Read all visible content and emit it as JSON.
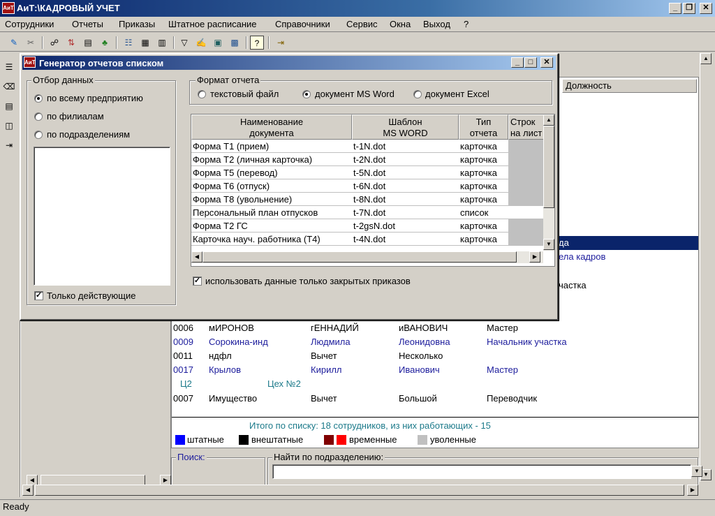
{
  "window": {
    "title": "АиТ:\\КАДРОВЫЙ УЧЕТ",
    "icon": "app-logo-icon"
  },
  "menu": [
    "Сотрудники",
    "Отчеты",
    "Приказы",
    "Штатное расписание",
    "Справочники",
    "Сервис",
    "Окна",
    "Выход",
    "?"
  ],
  "main_list": {
    "column_position": "Должность",
    "partial_rows": [
      {
        "text": "да"
      },
      {
        "text": "ела кадров"
      },
      {
        "text": "частка"
      }
    ],
    "rows": [
      {
        "id": "0006",
        "last": "мИРОНОВ",
        "first": "гЕННАДИЙ",
        "middle": "иВАНОВИЧ",
        "position": "Мастер",
        "style": "black"
      },
      {
        "id": "0009",
        "last": "Сорокина-инд",
        "first": "Людмила",
        "middle": "Леонидовна",
        "position": "Начальник участка",
        "style": "navy"
      },
      {
        "id": "0011",
        "last": "ндфл",
        "first": "Вычет",
        "middle": "Несколько",
        "position": "",
        "style": "black"
      },
      {
        "id": "0017",
        "last": "Крылов",
        "first": "Кирилл",
        "middle": "Иванович",
        "position": "Мастер",
        "style": "navy"
      },
      {
        "id": "",
        "last": "Ц2",
        "first": "Цех №2",
        "middle": "",
        "position": "",
        "style": "teal"
      },
      {
        "id": "0007",
        "last": "Имущество",
        "first": "Вычет",
        "middle": "Большой",
        "position": "Переводчик",
        "style": "black"
      }
    ],
    "total": "Итого по списку: 18 сотрудников, из них работающих - 15",
    "legend": [
      {
        "label": "штатные",
        "colors": [
          "#0000ff"
        ]
      },
      {
        "label": "внештатные",
        "colors": [
          "#000000"
        ]
      },
      {
        "label": "временные",
        "colors": [
          "#800000",
          "#ff0000"
        ]
      },
      {
        "label": "уволенные",
        "colors": [
          "#c0c0c0"
        ]
      }
    ],
    "search_label": "Поиск:",
    "find_by_dept_label": "Найти по подразделению:"
  },
  "dialog": {
    "title": "Генератор отчетов списком",
    "selection_group": "Отбор данных",
    "selection_options": [
      "по всему предприятию",
      "по филиалам",
      "по подразделениям"
    ],
    "selection_checked": 0,
    "only_active_label": "Только действующие",
    "only_active": true,
    "format_group": "Формат отчета",
    "format_options": [
      "текстовый файл",
      "документ MS Word",
      "документ Excel"
    ],
    "format_checked": 1,
    "grid_headers": [
      "Наименование\nдокумента",
      "Шаблон\nMS WORD",
      "Тип\nотчета",
      "Строк\nна лист"
    ],
    "grid_rows": [
      {
        "name": "Форма Т1 (прием)",
        "template": "t-1N.dot",
        "type": "карточка",
        "grey": true
      },
      {
        "name": "Форма Т2 (личная карточка)",
        "template": "t-2N.dot",
        "type": "карточка",
        "grey": true
      },
      {
        "name": "Форма Т5 (перевод)",
        "template": "t-5N.dot",
        "type": "карточка",
        "grey": true
      },
      {
        "name": "Форма Т6 (отпуск)",
        "template": "t-6N.dot",
        "type": "карточка",
        "grey": true
      },
      {
        "name": "Форма Т8 (увольнение)",
        "template": "t-8N.dot",
        "type": "карточка",
        "grey": true
      },
      {
        "name": "Персональный план отпусков",
        "template": "t-7N.dot",
        "type": "список",
        "grey": false
      },
      {
        "name": "Форма Т2 ГС",
        "template": "t-2gsN.dot",
        "type": "карточка",
        "grey": true
      },
      {
        "name": "Карточка науч. работника (Т4)",
        "template": "t-4N.dot",
        "type": "карточка",
        "grey": true
      }
    ],
    "closed_orders_label": "использовать данные только закрытых приказов",
    "closed_orders": true
  },
  "status": "Ready"
}
